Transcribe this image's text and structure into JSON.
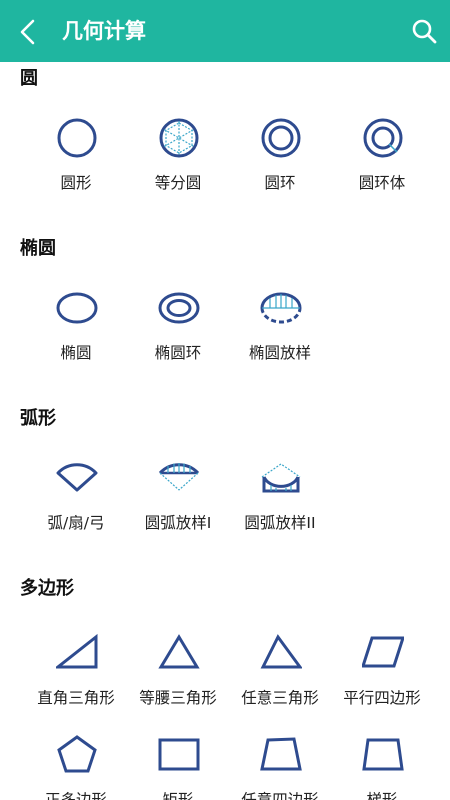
{
  "appbar": {
    "title": "几何计算",
    "bg": "#1fb6a0"
  },
  "sections": {
    "circle": {
      "title": "圆",
      "items": [
        "圆形",
        "等分圆",
        "圆环",
        "圆环体"
      ]
    },
    "ellipse": {
      "title": "椭圆",
      "items": [
        "椭圆",
        "椭圆环",
        "椭圆放样"
      ]
    },
    "arc": {
      "title": "弧形",
      "items": [
        "弧/扇/弓",
        "圆弧放样I",
        "圆弧放样II"
      ]
    },
    "polygon": {
      "title": "多边形",
      "items": [
        "直角三角形",
        "等腰三角形",
        "任意三角形",
        "平行四边形",
        "正多边形",
        "矩形",
        "任意四边形",
        "梯形"
      ]
    }
  },
  "colors": {
    "icon_stroke": "#2e4b8f",
    "icon_accent": "#3aa6c9"
  }
}
